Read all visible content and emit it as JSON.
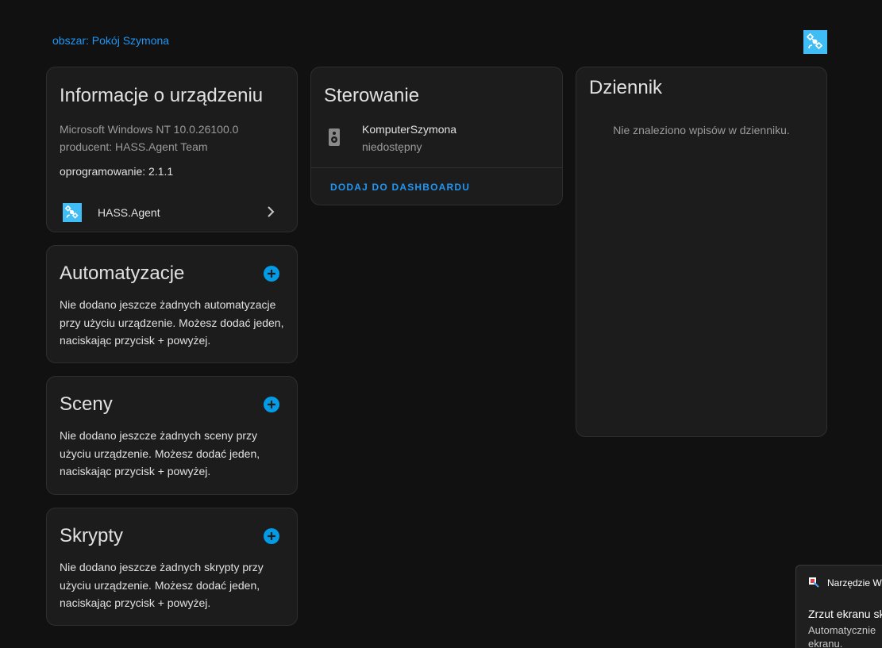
{
  "area_link": "obszar: Pokój Szymona",
  "device_info": {
    "title": "Informacje o urządzeniu",
    "model": "Microsoft Windows NT 10.0.26100.0",
    "manufacturer": "producent: HASS.Agent Team",
    "firmware": "oprogramowanie: 2.1.1",
    "integration_label": "HASS.Agent"
  },
  "automations": {
    "title": "Automatyzacje",
    "empty_text": "Nie dodano jeszcze żadnych automatyzacje przy użyciu urządzenie. Możesz dodać jeden, naciskając przycisk + powyżej."
  },
  "scenes": {
    "title": "Sceny",
    "empty_text": "Nie dodano jeszcze żadnych sceny przy użyciu urządzenie. Możesz dodać jeden, naciskając przycisk + powyżej."
  },
  "scripts": {
    "title": "Skrypty",
    "empty_text": "Nie dodano jeszcze żadnych skrypty przy użyciu urządzenie. Możesz dodać jeden, naciskając przycisk + powyżej."
  },
  "controls": {
    "title": "Sterowanie",
    "entity_name": "KomputerSzymona",
    "entity_state": "niedostępny",
    "add_to_dashboard": "DODAJ DO DASHBOARDU"
  },
  "logbook": {
    "title": "Dziennik",
    "empty_text": "Nie znaleziono wpisów w dzienniku."
  },
  "toast": {
    "app_name": "Narzędzie W",
    "title": "Zrzut ekranu sk",
    "body_line1": "Automatycznie",
    "body_line2": "ekranu."
  },
  "colors": {
    "accent": "#2196f3",
    "add_button": "#039be5",
    "hass_agent_logo": "#41bdf5"
  }
}
